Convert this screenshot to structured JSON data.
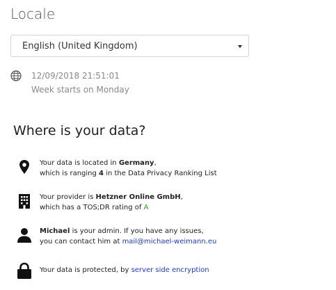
{
  "locale": {
    "title": "Locale",
    "selected_language": "English (United Kingdom)",
    "datetime": "12/09/2018 21:51:01",
    "week_start": "Week starts on Monday"
  },
  "data_section": {
    "title": "Where is your data?",
    "location": {
      "line1_prefix": "Your data is located in ",
      "country": "Germany",
      "line1_suffix": ",",
      "line2_prefix": "which is ranging ",
      "rank": "4",
      "line2_suffix": " in the Data Privacy Ranking List"
    },
    "provider": {
      "line1_prefix": "Your provider is ",
      "name": "Hetzner Online GmbH",
      "line1_suffix": ",",
      "line2_prefix": "which has a TOS;DR rating of ",
      "rating": "A",
      "rating_color": "#2aa02a"
    },
    "admin": {
      "name": "Michael",
      "line1_suffix": " is your admin. If you have any issues,",
      "line2_prefix": "you can contact him at ",
      "email": "mail@michael-weimann.eu"
    },
    "protection": {
      "prefix": "Your data is protected, by ",
      "link": "server side encryption"
    }
  },
  "colors": {
    "link": "#1a3bd6"
  }
}
